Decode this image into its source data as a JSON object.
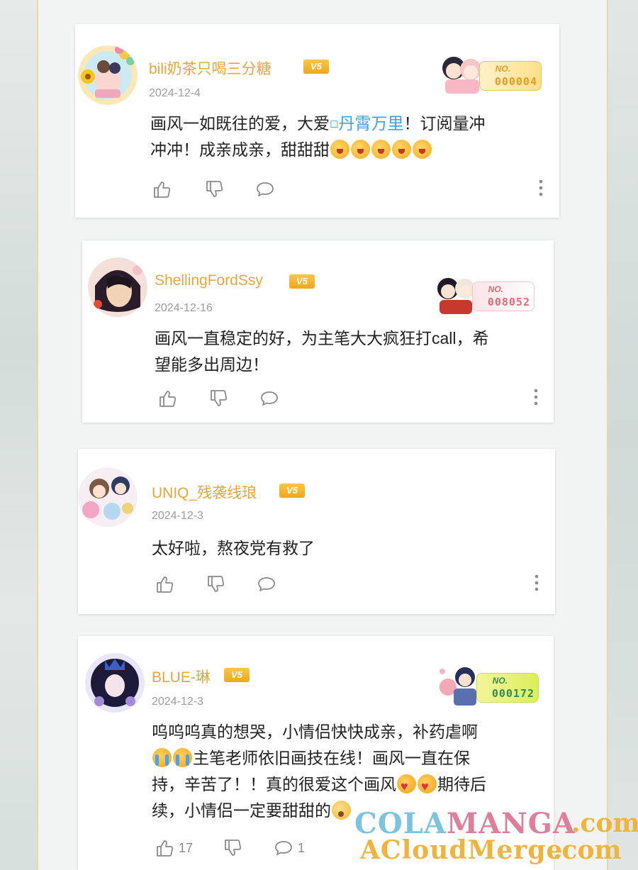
{
  "colors": {
    "username": "#e7a63a",
    "vip_badge": "#f4b12b",
    "link": "#3aa3e3",
    "date": "#9c9c9c"
  },
  "comments": [
    {
      "username": "bili奶茶只喝三分糖",
      "vip": "V5",
      "date": "2024-12-4",
      "content_parts": [
        "画风一如既往的爱，大爱",
        "丹霄万里",
        "！订阅量冲",
        "冲冲！成亲成亲，甜甜甜"
      ],
      "emoji_count": 5,
      "badge": {
        "label": "NO.",
        "number": "000004"
      }
    },
    {
      "username": "ShellingFordSsy",
      "vip": "V5",
      "date": "2024-12-16",
      "content_lines": [
        "画风一直稳定的好，为主笔大大疯狂打call，希",
        "望能多出周边！"
      ],
      "badge": {
        "label": "NO.",
        "number": "008052"
      }
    },
    {
      "username": "UNIQ_残袭线琅",
      "vip": "V5",
      "date": "2024-12-3",
      "content_lines": [
        "太好啦，熬夜党有救了"
      ]
    },
    {
      "username": "BLUE-琳",
      "vip": "V5",
      "date": "2024-12-3",
      "content_parts": [
        "呜呜呜真的想哭，小情侣快快成亲，补药虐啊",
        "主笔老师依旧画技在线！画风一直在保",
        "持，辛苦了！！真的很爱这个画风",
        "期待后",
        "续，小情侣一定要甜甜的"
      ],
      "badge": {
        "label": "NO.",
        "number": "000172"
      },
      "like_count": "17",
      "reply_count": "1"
    }
  ],
  "icons": [
    "thumbs-up-icon",
    "thumbs-down-icon",
    "comment-bubble-icon",
    "more-vertical-icon",
    "link-topic-icon"
  ],
  "watermark": {
    "line1_a": "COLA",
    "line1_b": "MANGA",
    "line1_c": ".com",
    "line2_a": "ACloudMerge",
    "line2_b": ".com"
  }
}
